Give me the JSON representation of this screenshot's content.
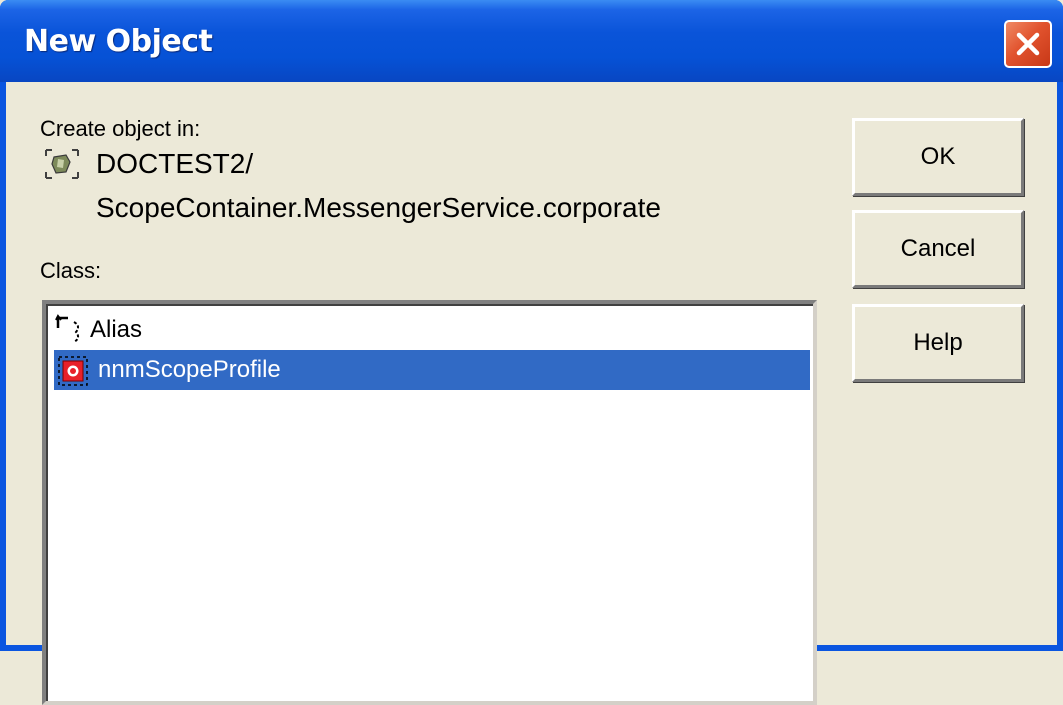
{
  "window": {
    "title": "New Object"
  },
  "location": {
    "label": "Create object in:",
    "path_line1": "DOCTEST2/",
    "path_line2": "ScopeContainer.MessengerService.corporate"
  },
  "class_section": {
    "label": "Class:",
    "items": [
      {
        "label": "Alias",
        "icon": "alias-icon",
        "selected": false
      },
      {
        "label": "nnmScopeProfile",
        "icon": "scope-profile-icon",
        "selected": true
      }
    ]
  },
  "buttons": {
    "ok": "OK",
    "cancel": "Cancel",
    "help": "Help"
  },
  "colors": {
    "titlebar": "#0a54d9",
    "selection": "#316ac5",
    "dialog_bg": "#ece9d8",
    "close_button": "#e1532e"
  }
}
